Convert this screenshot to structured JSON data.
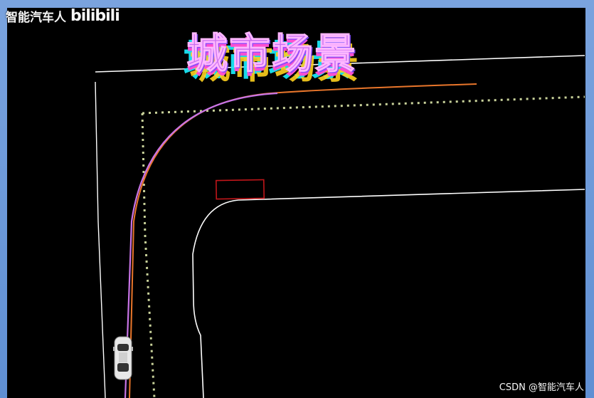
{
  "watermark": {
    "channel": "智能汽车人",
    "platform_logo": "bilibili"
  },
  "title": "城市场景",
  "footer_watermark": "CSDN @智能汽车人",
  "colors": {
    "background": "#000000",
    "lane_line": "#ffffff",
    "boundary_dotted": "#c9d29a",
    "planned_path_orange": "#e9762b",
    "planned_path_violet": "#c874e6",
    "obstacle": "#c0161a",
    "ego_car": "#e8e8e8"
  }
}
